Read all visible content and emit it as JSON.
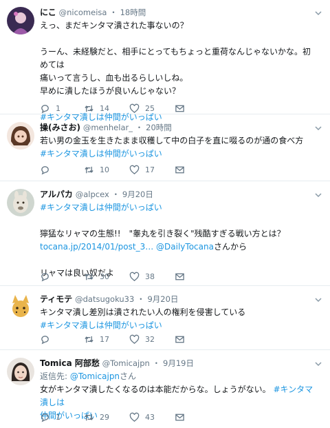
{
  "tweets": [
    {
      "name": "にこ",
      "handle": "@nicomeisa",
      "time": "18時間",
      "lines": [
        "えっ、まだキンタマ潰された事ないの？",
        "",
        "うーん、未経験だと、相手にとってもちょっと重荷なんじゃないかな。初めては",
        "痛いって言うし、血も出るらしいしね。",
        "早めに潰したほうが良いんじゃない？",
        ""
      ],
      "hashtag": "#キンタマ潰しは仲間がいっぱい",
      "reply_count": "1",
      "retweet_count": "14",
      "like_count": "25",
      "avatar_colors": [
        "#3a2a52",
        "#e8c8d8",
        "#9c5aa8"
      ]
    },
    {
      "name": "操(みさお)",
      "handle": "@menhelar_",
      "time": "20時間",
      "lines": [
        "若い男の金玉を生きたまま収穫して中の白子を直に啜るのが通の食べ方"
      ],
      "hashtag": "#キンタマ潰しは仲間がいっぱい",
      "reply_count": "",
      "retweet_count": "10",
      "like_count": "17",
      "avatar_colors": [
        "#f3e6de",
        "#5a3826",
        "#f2d2c0"
      ]
    },
    {
      "name": "アルパカ",
      "handle": "@alpcex",
      "time": "9月20日",
      "hashtag_first": "#キンタマ潰しは仲間がいっぱい",
      "lines": [
        "",
        "獰猛なリャマの生態!!　\"睾丸を引き裂く\"残酷すぎる戦い方とは？"
      ],
      "link": "tocana.jp/2014/01/post_3…",
      "mention": "@DailyTocana",
      "link_suffix": "さんから",
      "closing": "リャマは良い奴だよ",
      "reply_count": "",
      "retweet_count": "30",
      "like_count": "38",
      "avatar_colors": [
        "#cfd6cf",
        "#e9e4da",
        "#8a7f70"
      ]
    },
    {
      "name": "ティモテ",
      "handle": "@datsugoku33",
      "time": "9月20日",
      "lines": [
        "キンタマ潰し差別は潰されたい人の権利を侵害している"
      ],
      "hashtag": "#キンタマ潰しは仲間がいっぱい",
      "reply_count": "",
      "retweet_count": "17",
      "like_count": "32",
      "avatar_colors": [
        "#ffffff",
        "#e9b44c",
        "#3a2b1a"
      ]
    },
    {
      "name": "Tomica 阿部愁",
      "handle": "@Tomicajpn",
      "time": "9月19日",
      "reply_to_prefix": "返信先:",
      "reply_to_handle": "@Tomicajpn",
      "reply_to_suffix": "さん",
      "line1": "女がキンタマ潰したくなるのは本能だからな。しょうがない。",
      "hashtag_a": "#キンタマ潰しは",
      "hashtag_b": "仲間がいっぱい",
      "reply_count": "1",
      "retweet_count": "29",
      "like_count": "43",
      "avatar_colors": [
        "#e9e4df",
        "#2e2622",
        "#f0d6c6"
      ]
    }
  ],
  "separator": "・"
}
